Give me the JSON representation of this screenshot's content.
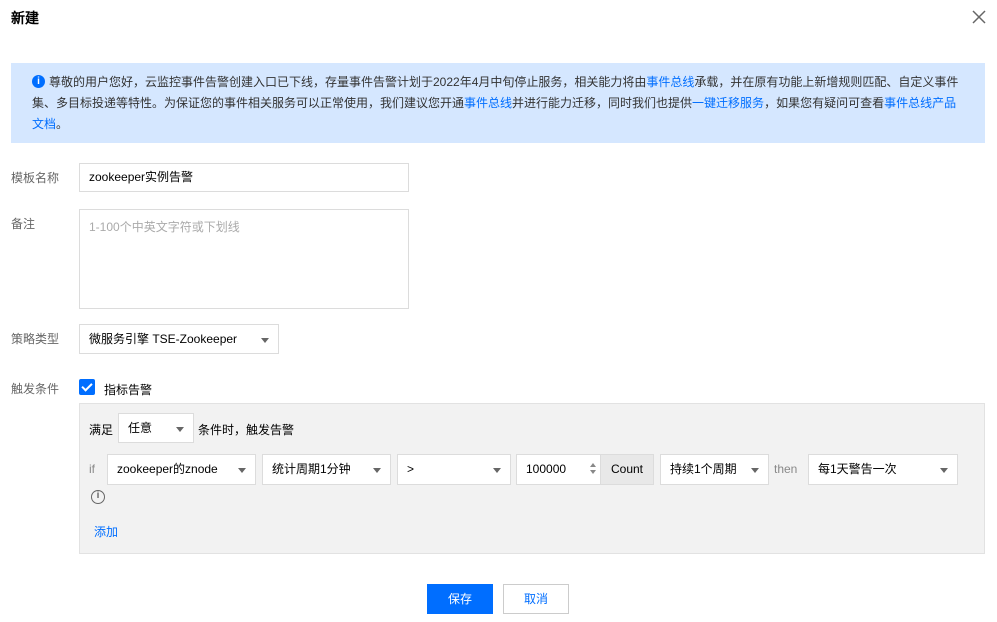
{
  "dialog": {
    "title": "新建"
  },
  "notice": {
    "p1": "尊敬的用户您好，云监控事件告警创建入口已下线，存量事件告警计划于2022年4月中旬停止服务，相关能力将由",
    "link1": "事件总线",
    "p2": "承载，并在原有功能上新增规则匹配、自定义事件集、多目标投递等特性。为保证您的事件相关服务可以正常使用，我们建议您开通",
    "link2": "事件总线",
    "p3": "并进行能力迁移，同时我们也提供",
    "link3": "一键迁移服务",
    "p4": "，如果您有疑问可查看",
    "link4": "事件总线产品文档",
    "p5": "。"
  },
  "form": {
    "template_name_label": "模板名称",
    "template_name_value": "zookeeper实例告警",
    "remark_label": "备注",
    "remark_placeholder": "1-100个中英文字符或下划线",
    "policy_type_label": "策略类型",
    "policy_type_value": "微服务引擎 TSE-Zookeeper",
    "trigger_label": "触发条件",
    "metric_alarm_label": "指标告警"
  },
  "condition": {
    "satisfy_label": "满足",
    "satisfy_value": "任意",
    "satisfy_suffix": "条件时，触发告警",
    "if_label": "if",
    "metric": "zookeeper的znode",
    "period": "统计周期1分钟",
    "operator": ">",
    "threshold": "100000",
    "unit": "Count",
    "duration": "持续1个周期",
    "then_label": "then",
    "frequency": "每1天警告一次",
    "add_label": "添加"
  },
  "buttons": {
    "save": "保存",
    "cancel": "取消"
  },
  "colors": {
    "accent": "#006eff",
    "notice_bg": "#d5e7ff"
  }
}
